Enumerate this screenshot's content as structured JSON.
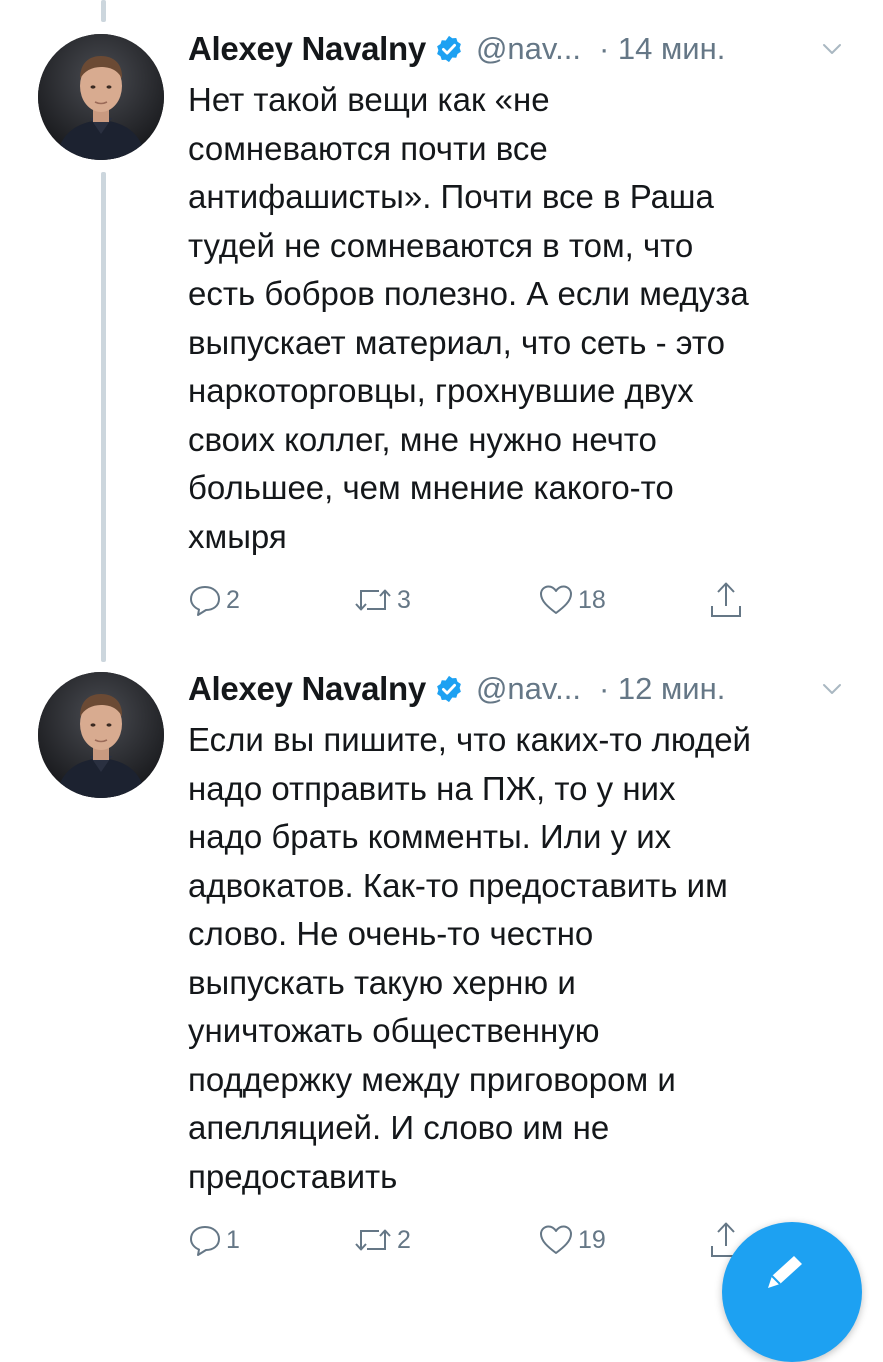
{
  "tweets": [
    {
      "name": "Alexey Navalny",
      "handle": "@nav...",
      "time": "· 14 мин.",
      "text": "Нет такой вещи как «не\nсомневаются почти все\nантифашисты». Почти все в Раша\nтудей не сомневаются в том, что\nесть бобров полезно. А если медуза\nвыпускает материал, что сеть - это\nнаркоторговцы, грохнувшие двух\nсвоих коллег, мне нужно нечто\nбольшее, чем мнение какого-то\nхмыря",
      "replies": "2",
      "retweets": "3",
      "likes": "18"
    },
    {
      "name": "Alexey Navalny",
      "handle": "@nav...",
      "time": "· 12 мин.",
      "text": "Если вы пишите, что каких-то людей\nнадо отправить на ПЖ, то у них\nнадо брать комменты. Или у их\nадвокатов. Как-то предоставить им\nслово. Не очень-то честно\nвыпускать такую херню и\nуничтожать общественную\nподдержку между приговором и\nапелляцией. И слово им не\nпредоставить",
      "replies": "1",
      "retweets": "2",
      "likes": "19"
    }
  ],
  "icons": {
    "verified": "verified-badge-icon",
    "chevron": "chevron-down-icon",
    "reply": "reply-icon",
    "retweet": "retweet-icon",
    "like": "heart-icon",
    "share": "share-icon",
    "compose": "compose-icon"
  },
  "colors": {
    "accent": "#1da1f2",
    "muted": "#657786",
    "text": "#14171a",
    "thread_line": "#ccd6dd"
  }
}
